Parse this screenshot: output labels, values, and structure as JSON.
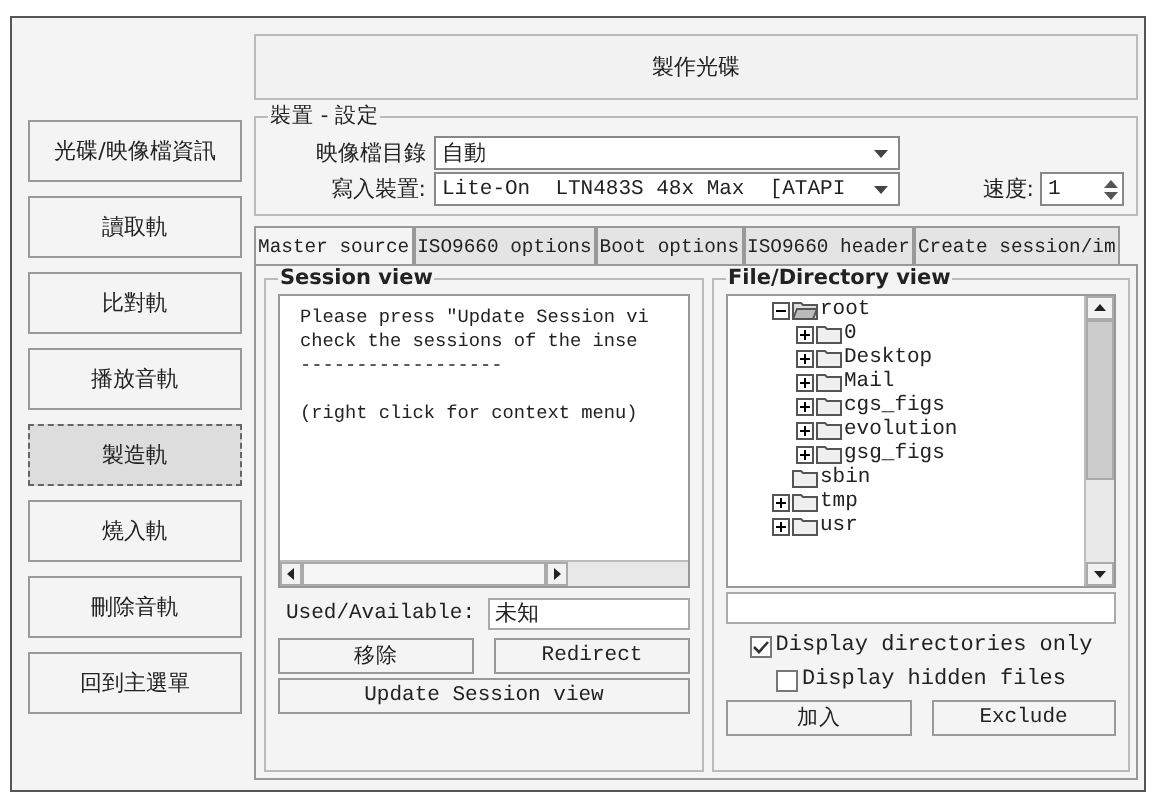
{
  "nav_buttons": [
    {
      "label": "光碟/映像檔資訊",
      "selected": false
    },
    {
      "label": "讀取軌",
      "selected": false
    },
    {
      "label": "比對軌",
      "selected": false
    },
    {
      "label": "播放音軌",
      "selected": false
    },
    {
      "label": "製造軌",
      "selected": true
    },
    {
      "label": "燒入軌",
      "selected": false
    },
    {
      "label": "刪除音軌",
      "selected": false
    },
    {
      "label": "回到主選單",
      "selected": false
    }
  ],
  "header": "製作光碟",
  "device_settings": {
    "title": "裝置 - 設定",
    "image_dir_label": "映像檔目錄",
    "image_dir_value": "自動",
    "writer_label": "寫入裝置:",
    "writer_value": "Lite-On  LTN483S 48x Max  [ATAPI",
    "speed_label": "速度:",
    "speed_value": "1"
  },
  "tabs": [
    {
      "label": "Master source",
      "selected": true
    },
    {
      "label": "ISO9660 options",
      "selected": false
    },
    {
      "label": "Boot options",
      "selected": false
    },
    {
      "label": "ISO9660 header",
      "selected": false
    },
    {
      "label": "Create session/im",
      "selected": false
    }
  ],
  "session_view": {
    "title": "Session view",
    "message": [
      "Please press \"Update Session vi",
      "check the sessions of the inse"
    ],
    "separator": "------------------",
    "hint": "(right click for context menu)",
    "used_label": "Used/Available:",
    "used_value": "未知",
    "buttons": [
      "移除",
      "Redirect"
    ],
    "update_button": "Update Session view"
  },
  "file_view": {
    "title": "File/Directory view",
    "tree": [
      {
        "name": "root",
        "expanded": true,
        "children": [
          {
            "name": "0",
            "expanded": false
          },
          {
            "name": "Desktop",
            "expanded": false
          },
          {
            "name": "Mail",
            "expanded": false
          },
          {
            "name": "cgs_figs",
            "expanded": false
          },
          {
            "name": "evolution",
            "expanded": false
          },
          {
            "name": "gsg_figs",
            "expanded": false
          }
        ]
      },
      {
        "name": "sbin"
      },
      {
        "name": "tmp",
        "expanded": false
      },
      {
        "name": "usr",
        "expanded": false
      }
    ],
    "options": [
      {
        "label": "Display directories only",
        "checked": true
      },
      {
        "label": "Display hidden files",
        "checked": false
      }
    ],
    "buttons": [
      "加入",
      "Exclude"
    ]
  }
}
